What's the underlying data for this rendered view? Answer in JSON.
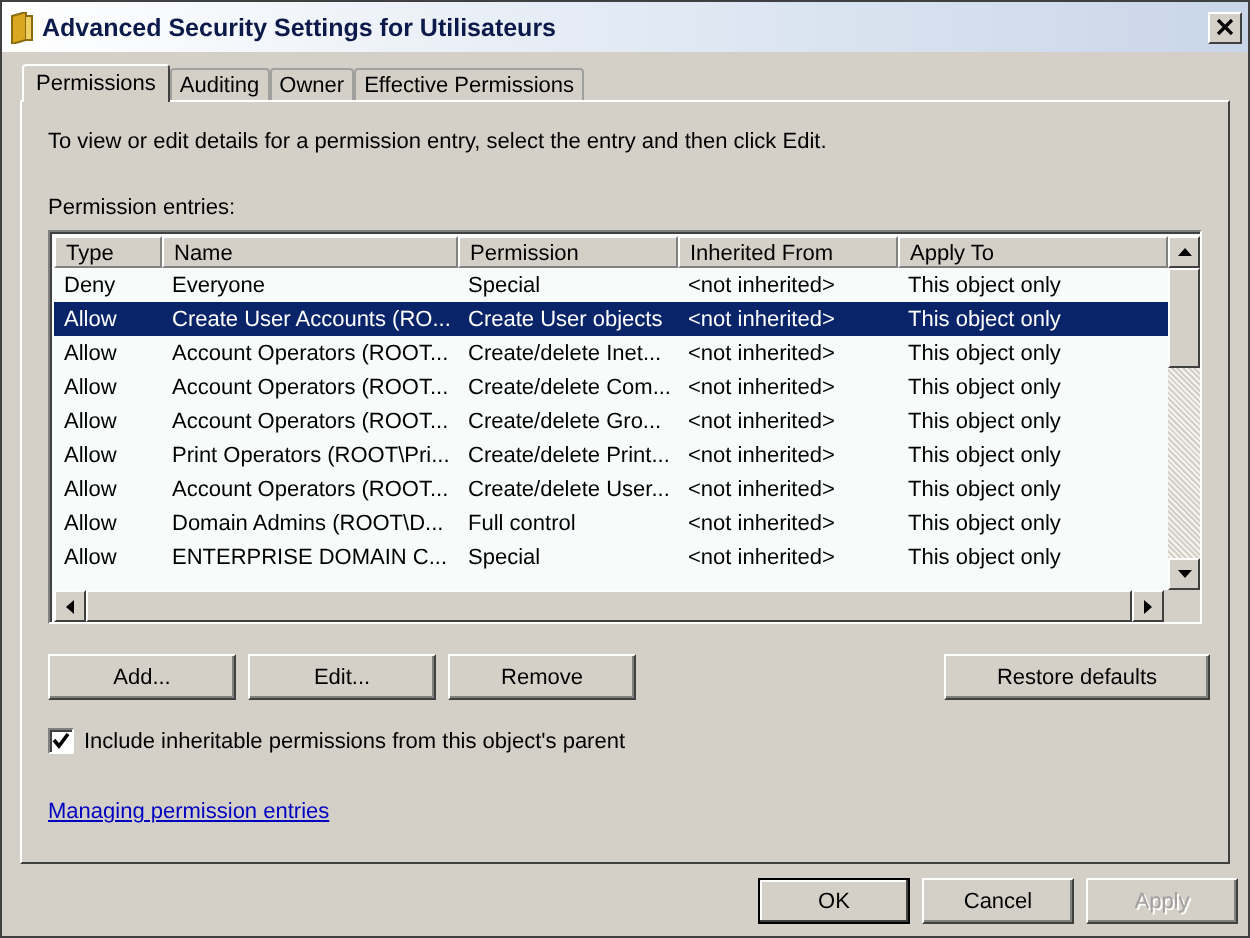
{
  "window": {
    "title": "Advanced Security Settings for Utilisateurs"
  },
  "tabs": [
    {
      "label": "Permissions",
      "selected": true
    },
    {
      "label": "Auditing",
      "selected": false
    },
    {
      "label": "Owner",
      "selected": false
    },
    {
      "label": "Effective Permissions",
      "selected": false
    }
  ],
  "instructions": "To view or edit details for a permission entry, select the entry and then click Edit.",
  "list_label": "Permission entries:",
  "table": {
    "columns": [
      "Type",
      "Name",
      "Permission",
      "Inherited From",
      "Apply To"
    ],
    "rows": [
      {
        "cells": [
          "Deny",
          "Everyone",
          "Special",
          "<not inherited>",
          "This object only"
        ],
        "selected": false
      },
      {
        "cells": [
          "Allow",
          "Create User Accounts (RO...",
          "Create User objects",
          "<not inherited>",
          "This object only"
        ],
        "selected": true
      },
      {
        "cells": [
          "Allow",
          "Account Operators (ROOT...",
          "Create/delete Inet...",
          "<not inherited>",
          "This object only"
        ],
        "selected": false
      },
      {
        "cells": [
          "Allow",
          "Account Operators (ROOT...",
          "Create/delete Com...",
          "<not inherited>",
          "This object only"
        ],
        "selected": false
      },
      {
        "cells": [
          "Allow",
          "Account Operators (ROOT...",
          "Create/delete Gro...",
          "<not inherited>",
          "This object only"
        ],
        "selected": false
      },
      {
        "cells": [
          "Allow",
          "Print Operators (ROOT\\Pri...",
          "Create/delete Print...",
          "<not inherited>",
          "This object only"
        ],
        "selected": false
      },
      {
        "cells": [
          "Allow",
          "Account Operators (ROOT...",
          "Create/delete User...",
          "<not inherited>",
          "This object only"
        ],
        "selected": false
      },
      {
        "cells": [
          "Allow",
          "Domain Admins (ROOT\\D...",
          "Full control",
          "<not inherited>",
          "This object only"
        ],
        "selected": false
      },
      {
        "cells": [
          "Allow",
          "ENTERPRISE DOMAIN C...",
          "Special",
          "<not inherited>",
          "This object only"
        ],
        "selected": false
      }
    ]
  },
  "action_buttons": [
    "Add...",
    "Edit...",
    "Remove"
  ],
  "restore_button": "Restore defaults",
  "inherit_checkbox": {
    "label": "Include inheritable permissions from this object's parent",
    "checked": true
  },
  "help_link": "Managing permission entries",
  "dialog_buttons": [
    {
      "label": "OK",
      "disabled": false,
      "default": true
    },
    {
      "label": "Cancel",
      "disabled": false,
      "default": false
    },
    {
      "label": "Apply",
      "disabled": true,
      "default": false
    }
  ]
}
